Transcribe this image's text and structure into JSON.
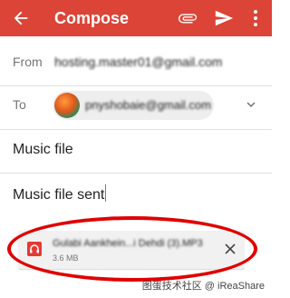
{
  "toolbar": {
    "title": "Compose",
    "back_icon": "arrow-back-icon",
    "attach_icon": "paperclip-icon",
    "send_icon": "send-icon",
    "more_icon": "more-vert-icon",
    "color": "#db4437"
  },
  "from": {
    "label": "From",
    "value": "hosting.master01@gmail.com"
  },
  "to": {
    "label": "To",
    "recipient": "pnyshobaie@gmail.com"
  },
  "subject": "Music file",
  "body": "Music file sent",
  "attachment": {
    "name": "Gulabi Aankhein...i Dehdi (3).MP3",
    "size": "3.6 MB",
    "icon": "audio-file-icon",
    "remove_icon": "close-icon"
  },
  "watermark": "图蛋技术社区 @ iReaShare"
}
